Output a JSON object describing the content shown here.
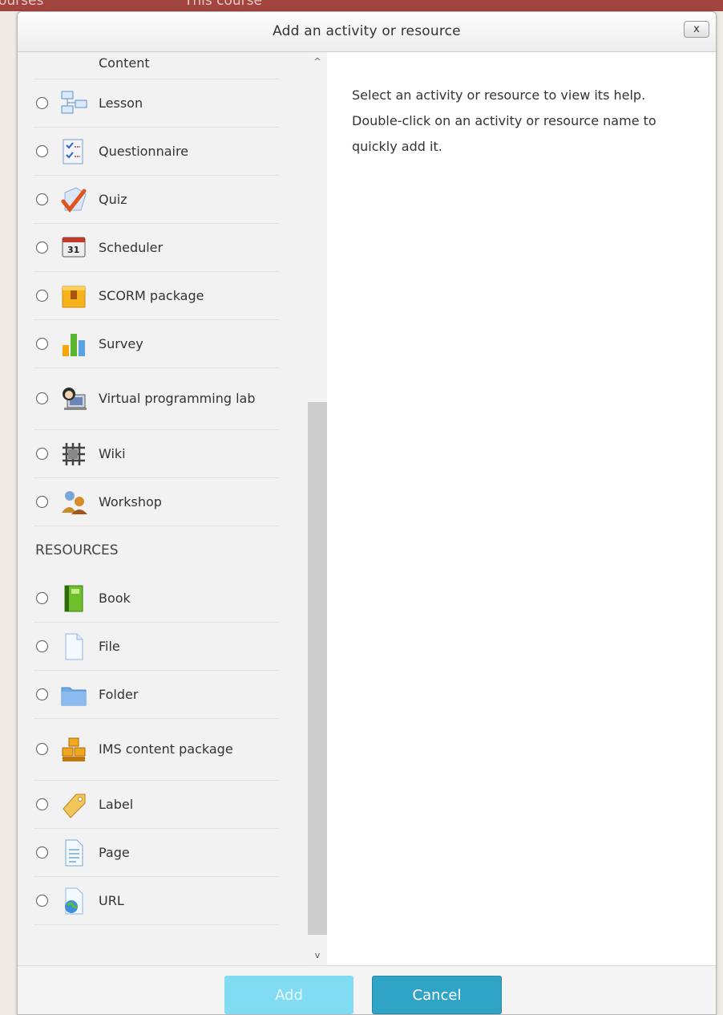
{
  "background": {
    "topbar_left": "ourses",
    "topbar_right": "This course"
  },
  "dialog": {
    "title": "Add an activity or resource",
    "close_label": "x"
  },
  "activities": [
    {
      "label": "Content",
      "icon": "h5p-icon"
    },
    {
      "label": "Lesson",
      "icon": "lesson-icon"
    },
    {
      "label": "Questionnaire",
      "icon": "questionnaire-icon"
    },
    {
      "label": "Quiz",
      "icon": "quiz-icon"
    },
    {
      "label": "Scheduler",
      "icon": "scheduler-icon"
    },
    {
      "label": "SCORM package",
      "icon": "scorm-icon"
    },
    {
      "label": "Survey",
      "icon": "survey-icon"
    },
    {
      "label": "Virtual programming lab",
      "icon": "vpl-icon"
    },
    {
      "label": "Wiki",
      "icon": "wiki-icon"
    },
    {
      "label": "Workshop",
      "icon": "workshop-icon"
    }
  ],
  "resources_heading": "RESOURCES",
  "resources": [
    {
      "label": "Book",
      "icon": "book-icon"
    },
    {
      "label": "File",
      "icon": "file-icon"
    },
    {
      "label": "Folder",
      "icon": "folder-icon"
    },
    {
      "label": "IMS content package",
      "icon": "ims-package-icon"
    },
    {
      "label": "Label",
      "icon": "label-icon"
    },
    {
      "label": "Page",
      "icon": "page-icon"
    },
    {
      "label": "URL",
      "icon": "url-icon"
    }
  ],
  "help_text": "Select an activity or resource to view its help. Double-click on an activity or resource name to quickly add it.",
  "buttons": {
    "add": "Add",
    "cancel": "Cancel"
  },
  "colors": {
    "primary": "#2fa4c7",
    "primary_disabled": "#7fdcf2",
    "page_band": "#a1453e"
  }
}
